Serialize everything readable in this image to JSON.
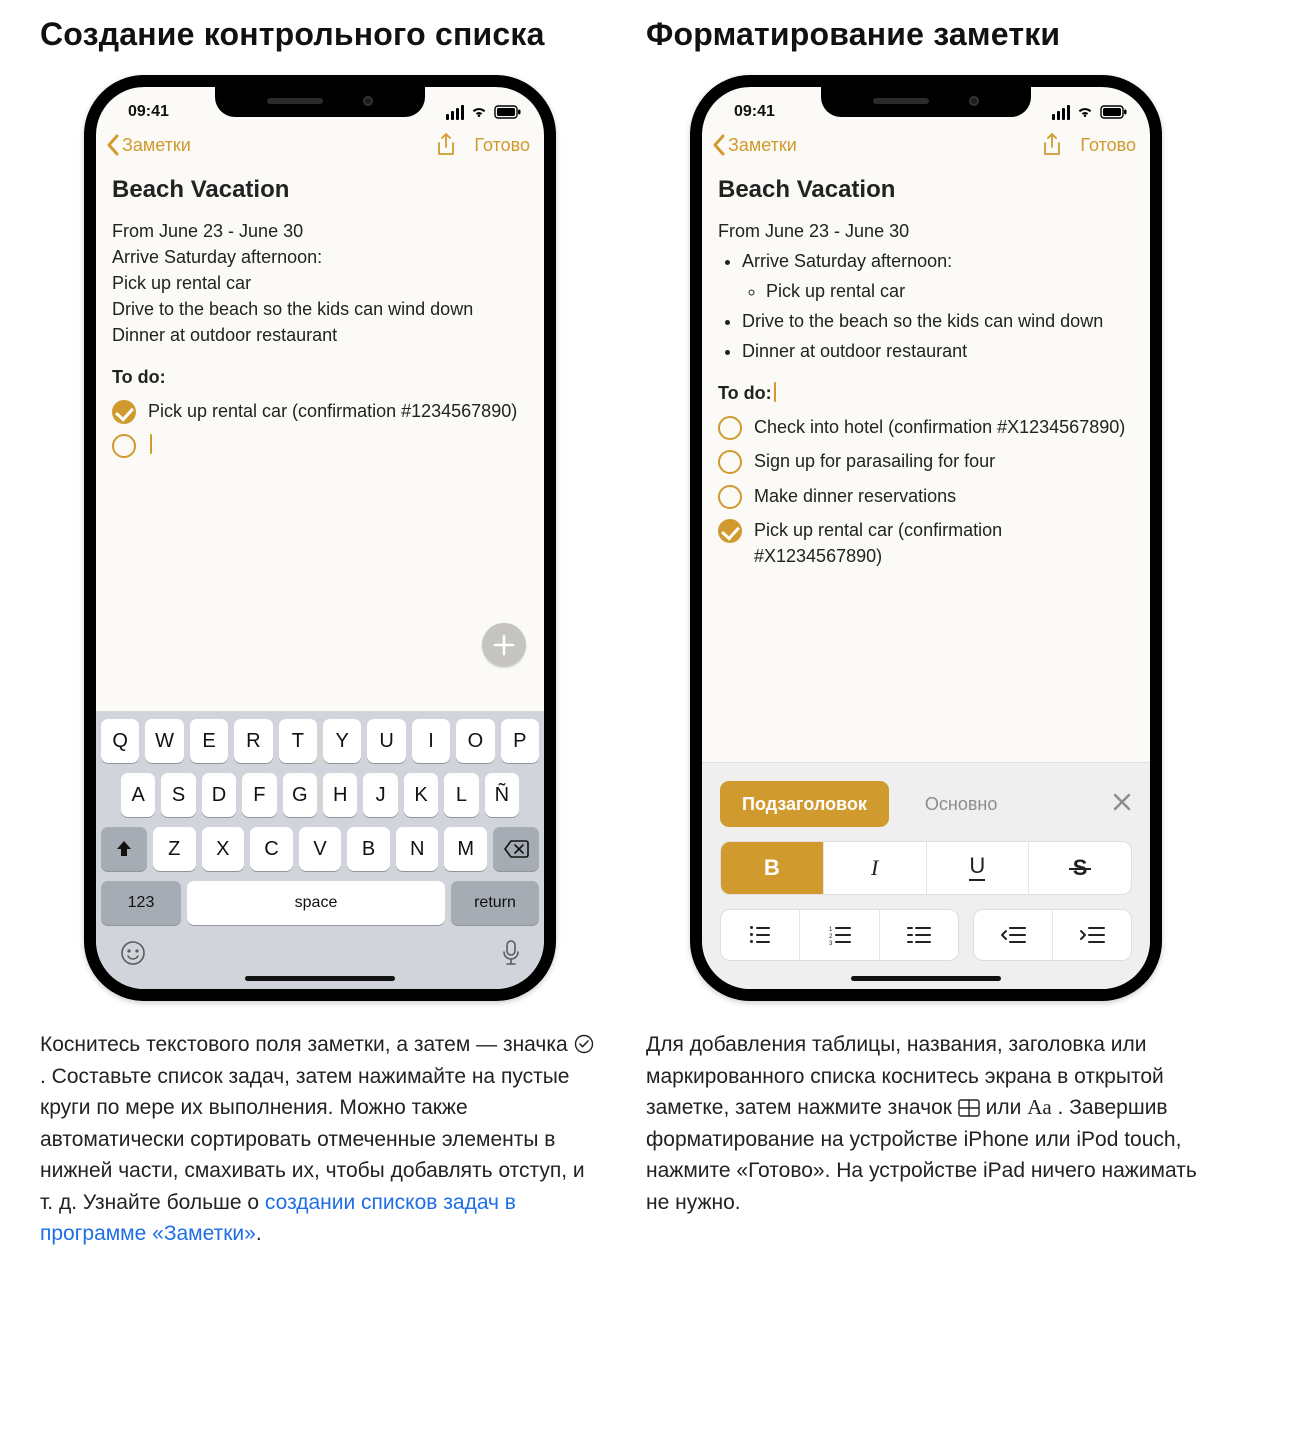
{
  "left": {
    "heading": "Создание контрольного списка",
    "status_time": "09:41",
    "nav": {
      "back": "Заметки",
      "done": "Готово"
    },
    "note": {
      "title": "Beach Vacation",
      "line1": "From June 23 - June 30",
      "line2": "Arrive Saturday afternoon:",
      "line3": "Pick up rental car",
      "line4": "Drive to the beach so the kids can wind down",
      "line5": "Dinner at outdoor restaurant",
      "todo_h": "To do:",
      "todo1": "Pick up rental car (confirmation #1234567890)"
    },
    "keyboard": {
      "r1": [
        "Q",
        "W",
        "E",
        "R",
        "T",
        "Y",
        "U",
        "I",
        "O",
        "P"
      ],
      "r2": [
        "A",
        "S",
        "D",
        "F",
        "G",
        "H",
        "J",
        "K",
        "L",
        "Ñ"
      ],
      "r3": [
        "Z",
        "X",
        "C",
        "V",
        "B",
        "N",
        "M"
      ],
      "num": "123",
      "space": "space",
      "ret": "return"
    },
    "caption_a": "Коснитесь текстового поля заметки, а затем — значка ",
    "caption_b": ". Составьте список задач, затем нажимайте на пустые круги по мере их выполнения. Можно также автоматически сортировать отмеченные элементы в нижней части, смахивать их, чтобы добавлять отступ, и т. д. Узнайте больше о ",
    "caption_link": "создании списков задач в программе «Заметки»",
    "caption_end": "."
  },
  "right": {
    "heading": "Форматирование заметки",
    "status_time": "09:41",
    "nav": {
      "back": "Заметки",
      "done": "Готово"
    },
    "note": {
      "title": "Beach Vacation",
      "line1": "From June 23 - June 30",
      "b1": "Arrive Saturday afternoon:",
      "b1a": "Pick up rental car",
      "b2": "Drive to the beach so the kids can wind down",
      "b3": "Dinner at outdoor restaurant",
      "todo_h": "To do:",
      "t1": "Check into hotel (confirmation #X1234567890)",
      "t2": "Sign up for parasailing for four",
      "t3": "Make dinner reservations",
      "t4": "Pick up rental car (confirmation #X1234567890)"
    },
    "fmt": {
      "chip_active": "Подзаголовок",
      "chip_ghost": "Основно",
      "b": "B",
      "i": "I",
      "u": "U",
      "s": "S"
    },
    "caption_a": "Для добавления таблицы, названия, заголовка или маркированного списка коснитесь экрана в открытой заметке, затем нажмите значок ",
    "caption_mid": " или ",
    "caption_aa": "Aа",
    "caption_b": ". Завершив форматирование на устройстве iPhone или iPod touch, нажмите «Готово». На устройстве iPad ничего нажимать не нужно."
  }
}
